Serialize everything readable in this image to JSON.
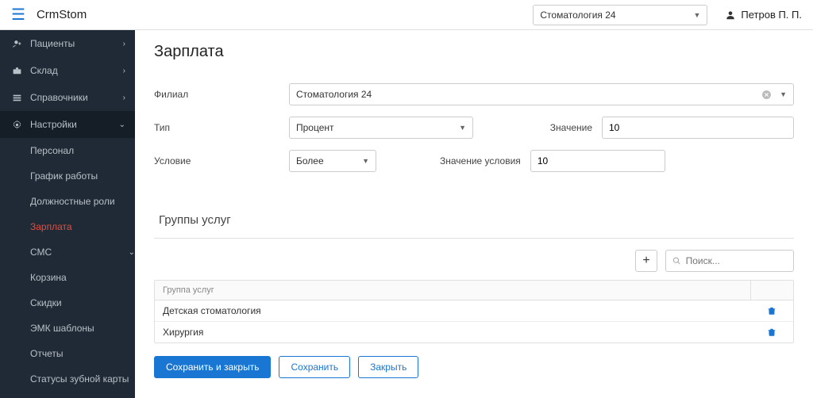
{
  "brand": "CrmStom",
  "org_selector": {
    "value": "Стоматология 24"
  },
  "user": {
    "name": "Петров П. П."
  },
  "sidebar": {
    "items": [
      {
        "label": "Пациенты",
        "icon": "user"
      },
      {
        "label": "Склад",
        "icon": "briefcase"
      },
      {
        "label": "Справочники",
        "icon": "list"
      },
      {
        "label": "Настройки",
        "icon": "gear",
        "expanded": true
      }
    ],
    "settings_children": [
      {
        "label": "Персонал"
      },
      {
        "label": "График работы"
      },
      {
        "label": "Должностные роли"
      },
      {
        "label": "Зарплата",
        "active": true
      },
      {
        "label": "СМС",
        "chevron": true
      },
      {
        "label": "Корзина"
      },
      {
        "label": "Скидки"
      },
      {
        "label": "ЭМК шаблоны"
      },
      {
        "label": "Отчеты"
      },
      {
        "label": "Статусы зубной карты"
      }
    ]
  },
  "page": {
    "title": "Зарплата"
  },
  "form": {
    "branch_label": "Филиал",
    "branch_value": "Стоматология 24",
    "type_label": "Тип",
    "type_value": "Процент",
    "value_label": "Значение",
    "value_value": "10",
    "condition_label": "Условие",
    "condition_value": "Более",
    "cond_value_label": "Значение условия",
    "cond_value_value": "10"
  },
  "section": {
    "title": "Группы услуг",
    "search_placeholder": "Поиск...",
    "column": "Группа услуг",
    "rows": [
      {
        "name": "Детская стоматология"
      },
      {
        "name": "Хирургия"
      }
    ]
  },
  "buttons": {
    "save_close": "Сохранить и закрыть",
    "save": "Сохранить",
    "close": "Закрыть"
  }
}
